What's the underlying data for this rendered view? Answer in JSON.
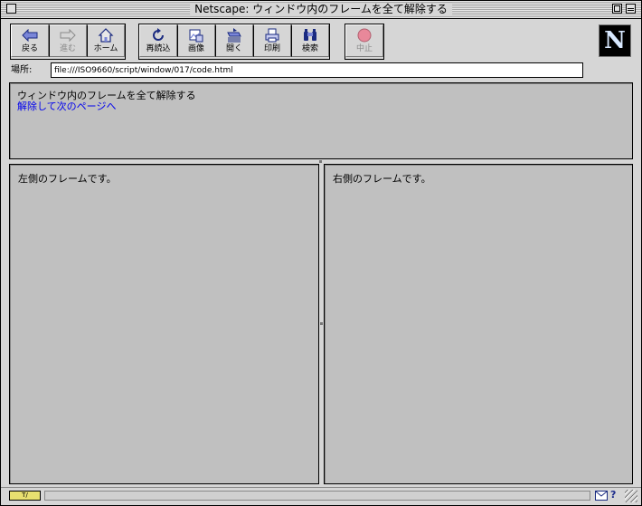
{
  "window": {
    "title": "Netscape: ウィンドウ内のフレームを全て解除する"
  },
  "toolbar": {
    "back": "戻る",
    "forward": "進む",
    "home": "ホーム",
    "reload": "再読込",
    "images": "画像",
    "open": "開く",
    "print": "印刷",
    "find": "検索",
    "stop": "中止",
    "logo": "N"
  },
  "location": {
    "label": "場所:",
    "url": "file:///ISO9660/script/window/017/code.html"
  },
  "frames": {
    "top": {
      "heading": "ウィンドウ内のフレームを全て解除する",
      "link": "解除して次のページへ"
    },
    "left": {
      "text": "左側のフレームです。"
    },
    "right": {
      "text": "右側のフレームです。"
    }
  },
  "status": {
    "security_label": "T/"
  },
  "colors": {
    "link": "#0000ee",
    "frame_bg": "#c0c0c0",
    "chrome_bg": "#d6d6d6",
    "stop_icon": "#e8889a"
  }
}
